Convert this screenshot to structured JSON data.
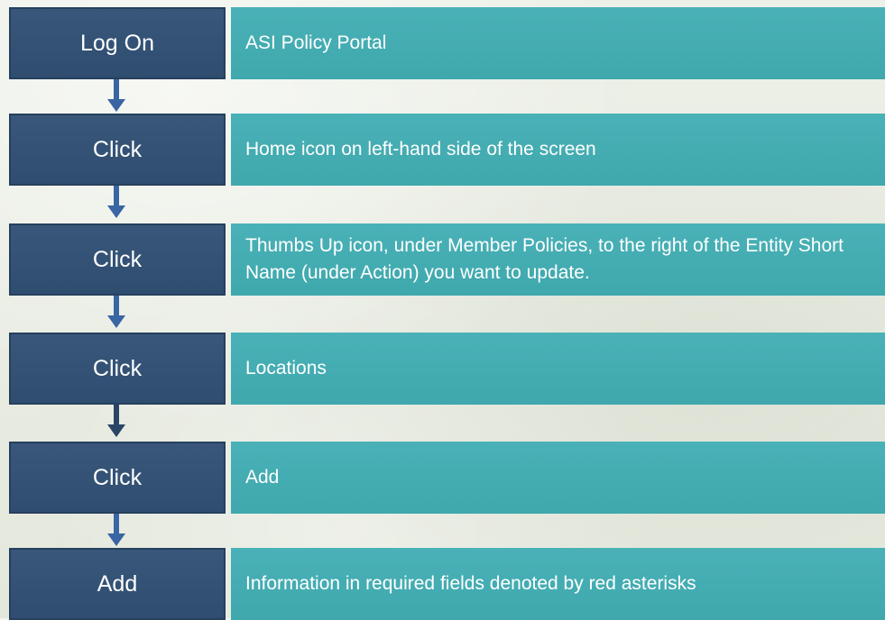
{
  "steps": [
    {
      "action": "Log On",
      "description": "ASI Policy Portal"
    },
    {
      "action": "Click",
      "description": "Home icon on left-hand side of the screen"
    },
    {
      "action": "Click",
      "description": "Thumbs Up icon, under Member Policies, to the right of the Entity Short Name (under Action) you want to update."
    },
    {
      "action": "Click",
      "description": "Locations"
    },
    {
      "action": "Click",
      "description": "Add"
    },
    {
      "action": "Add",
      "description": "Information in required fields denoted by red asterisks"
    }
  ],
  "colors": {
    "action_box": "#2f4d70",
    "description_box": "#45aeb3",
    "arrow": "#3a65a3",
    "background": "#e8ebe1"
  }
}
